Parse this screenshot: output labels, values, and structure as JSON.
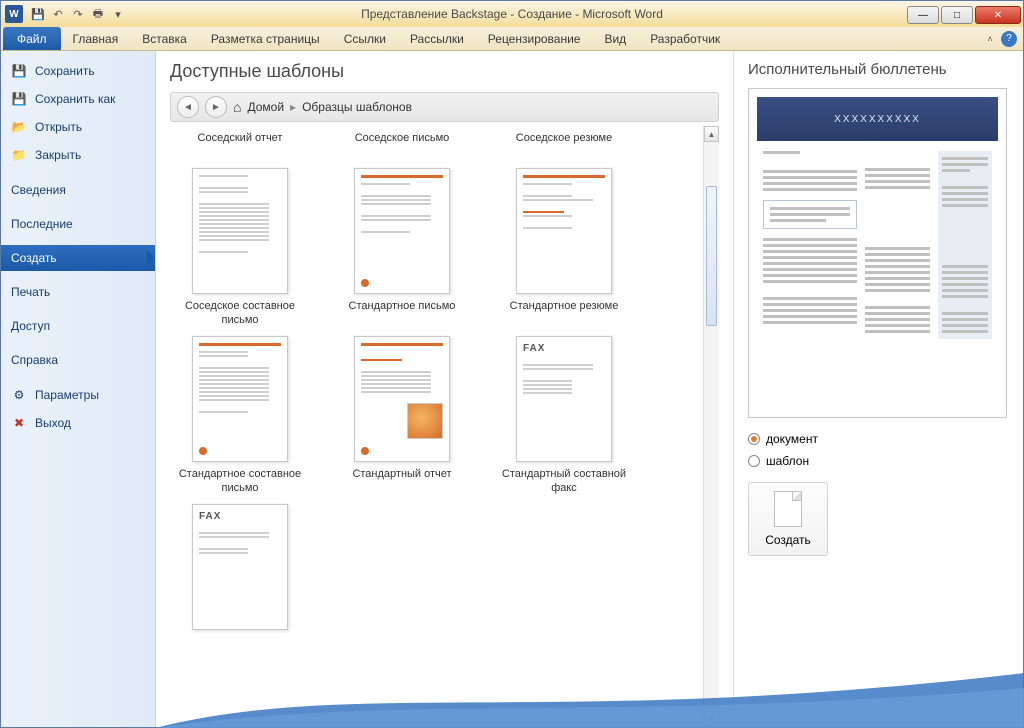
{
  "title": "Представление Backstage - Создание  -  Microsoft Word",
  "ribbon": {
    "file": "Файл",
    "tabs": [
      "Главная",
      "Вставка",
      "Разметка страницы",
      "Ссылки",
      "Рассылки",
      "Рецензирование",
      "Вид",
      "Разработчик"
    ]
  },
  "sidebar": {
    "save": "Сохранить",
    "saveas": "Сохранить как",
    "open": "Открыть",
    "close": "Закрыть",
    "info": "Сведения",
    "recent": "Последние",
    "new": "Создать",
    "print": "Печать",
    "share": "Доступ",
    "help": "Справка",
    "options": "Параметры",
    "exit": "Выход"
  },
  "center": {
    "heading": "Доступные шаблоны",
    "breadcrumb": {
      "home": "Домой",
      "current": "Образцы шаблонов"
    },
    "templates": [
      {
        "label": "Соседский отчет",
        "style": "report"
      },
      {
        "label": "Соседское письмо",
        "style": "letter"
      },
      {
        "label": "Соседское резюме",
        "style": "resume"
      },
      {
        "label": "Соседское составное письмо",
        "style": "merge-letter"
      },
      {
        "label": "Стандартное письмо",
        "style": "std-letter"
      },
      {
        "label": "Стандартное резюме",
        "style": "std-resume"
      },
      {
        "label": "Стандартное составное письмо",
        "style": "std-merge"
      },
      {
        "label": "Стандартный отчет",
        "style": "std-report"
      },
      {
        "label": "Стандартный составной факс",
        "style": "fax"
      },
      {
        "label": "",
        "style": "fax2"
      }
    ]
  },
  "right": {
    "title": "Исполнительный бюллетень",
    "preview_banner": "XXXXXXXXXX",
    "radio_doc": "документ",
    "radio_tpl": "шаблон",
    "create": "Создать"
  }
}
